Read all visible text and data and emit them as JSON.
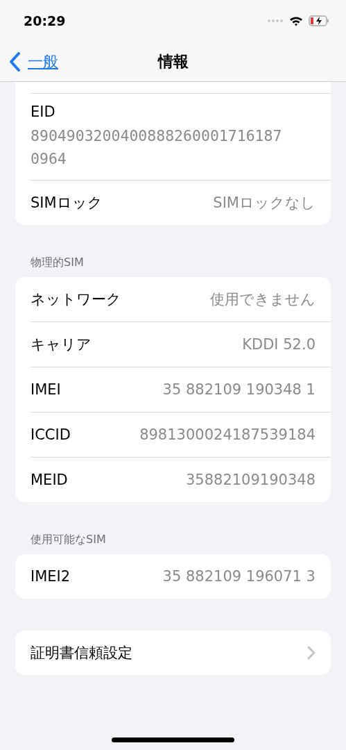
{
  "status_bar": {
    "time": "20:29"
  },
  "nav": {
    "back_label": "一般",
    "title": "情報"
  },
  "sections": [
    {
      "rows": [
        {
          "kind": "stacked",
          "label": "EID",
          "value": "89049032004008882600017161870964"
        },
        {
          "kind": "value",
          "label": "SIMロック",
          "value": "SIMロックなし"
        }
      ]
    },
    {
      "header": "物理的SIM",
      "rows": [
        {
          "kind": "value",
          "label": "ネットワーク",
          "value": "使用できません"
        },
        {
          "kind": "value",
          "label": "キャリア",
          "value": "KDDI 52.0"
        },
        {
          "kind": "value",
          "label": "IMEI",
          "value": "35 882109 190348 1"
        },
        {
          "kind": "value",
          "label": "ICCID",
          "value": "8981300024187539184"
        },
        {
          "kind": "value",
          "label": "MEID",
          "value": "35882109190348"
        }
      ]
    },
    {
      "header": "使用可能なSIM",
      "rows": [
        {
          "kind": "value",
          "label": "IMEI2",
          "value": "35 882109 196071 3"
        }
      ]
    },
    {
      "rows": [
        {
          "kind": "link",
          "label": "証明書信頼設定"
        }
      ]
    }
  ]
}
